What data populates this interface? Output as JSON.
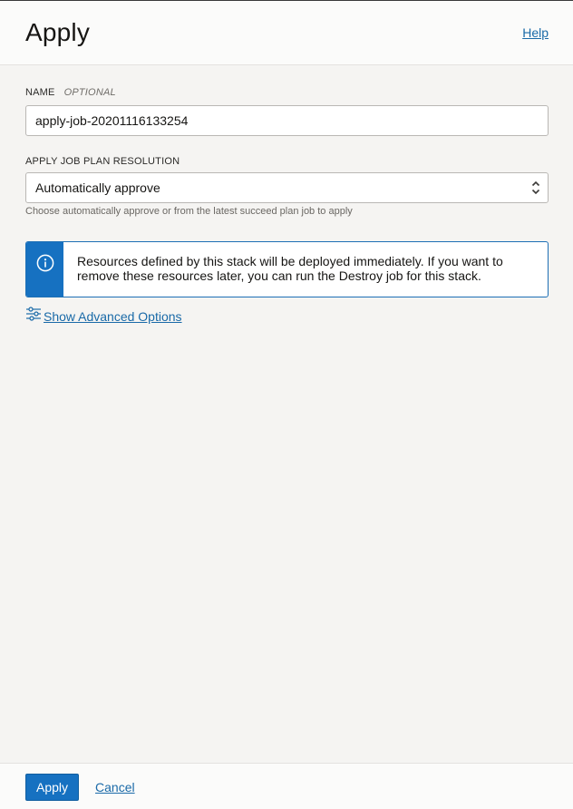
{
  "header": {
    "title": "Apply",
    "help_label": "Help"
  },
  "name_field": {
    "label": "NAME",
    "optional": "OPTIONAL",
    "value": "apply-job-20201116133254"
  },
  "plan_field": {
    "label": "APPLY JOB PLAN RESOLUTION",
    "selected": "Automatically approve",
    "helper": "Choose automatically approve or from the latest succeed plan job to apply"
  },
  "info": {
    "line1": "Resources defined by this stack will be deployed immediately. If you want to",
    "line2": "remove these resources later, you can run the Destroy job for this stack.",
    "icon": "info-circle-icon"
  },
  "advanced": {
    "label": "Show Advanced Options",
    "icon": "sliders-icon"
  },
  "footer": {
    "apply_label": "Apply",
    "cancel_label": "Cancel"
  },
  "colors": {
    "accent": "#1671c1",
    "link": "#1a6aa8",
    "border": "#b9b7b4"
  }
}
